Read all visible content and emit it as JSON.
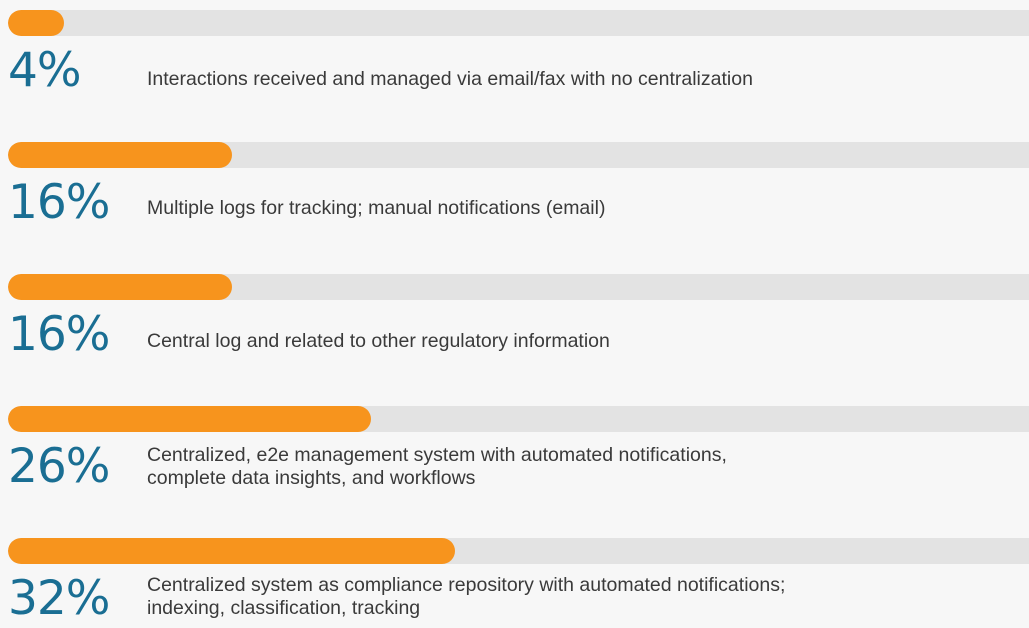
{
  "colors": {
    "bar": "#f7941d",
    "track": "#e3e3e3",
    "percent": "#1a6e93",
    "text": "#3a3a3a",
    "background": "#f7f7f7"
  },
  "chart_data": {
    "type": "bar",
    "orientation": "horizontal",
    "values": [
      4,
      16,
      16,
      26,
      32
    ],
    "unit": "%",
    "xlim": [
      0,
      100
    ],
    "grid": false,
    "categories": [
      "Interactions received and managed via email/fax with no centralization",
      "Multiple logs for tracking; manual notifications (email)",
      "Central log and related to other regulatory information",
      "Centralized, e2e management system with automated notifications,\ncomplete data insights, and workflows",
      "Centralized system as compliance repository with automated notifications;\nindexing, classification, tracking"
    ],
    "value_labels": [
      "4%",
      "16%",
      "16%",
      "26%",
      "32%"
    ]
  }
}
